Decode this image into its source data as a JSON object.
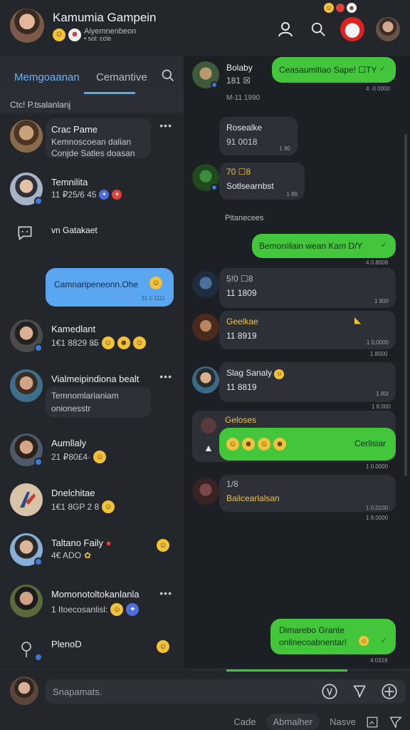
{
  "header": {
    "title": "Kamumia Gampein",
    "subtitle": "Aiyemnenbeon",
    "subtitle2": "• sol: ccle",
    "icons": [
      "user-icon",
      "search-icon",
      "notification-avatar",
      "profile-avatar"
    ]
  },
  "tabs": {
    "tab1": "Memgoaanan",
    "tab2": "Cemantive"
  },
  "section_label": "Ctc! P.tsalanlanj",
  "chats": [
    {
      "name": "Crac Pame",
      "line1": "Kemnoscoean dalian",
      "line2": "Conjde Satles doasan"
    },
    {
      "name": "Temnilita",
      "line1": "11 ₽25/6 45"
    },
    {
      "name": "vn Gatakaet"
    },
    {
      "name": "Kamedlant",
      "line1": "1€1 8829 8̶5"
    },
    {
      "name": "Vialmeipindiona bealt",
      "line1": "Temnomlarianiam",
      "line2": "onionesstr"
    },
    {
      "name": "Aumllaly",
      "line1": "21 ₽80£4·"
    },
    {
      "name": "Dnelchitae",
      "line1": "1€1 8GP 2 8"
    },
    {
      "name": "Taltano Faily",
      "line1": "4€ ADO"
    },
    {
      "name": "Momonotoltokanlanla",
      "line1": "1 Itoecosanlisl:"
    },
    {
      "name": "PlenoD"
    }
  ],
  "left_bubble": {
    "text": "Camnaripeneonn.Ohe",
    "time": "31 1 1111"
  },
  "messages": {
    "m1": {
      "name": "Bolaby",
      "line": "181 ☒",
      "meta": "M-11 1990"
    },
    "m1_out": {
      "text": "Ceasaumitiao Sape! ☐TY",
      "time": "4 ·0 0000"
    },
    "m2": {
      "name": "Rosealke",
      "line": "91 0018",
      "time": "1 80"
    },
    "m3": {
      "name": "70 ☐8",
      "line": "Sotlsearnbst",
      "time": "1 89"
    },
    "day": "Pitanecees",
    "m4_out": {
      "text": "Bemoniilain wean Kam D/Y",
      "time": "4 0.8008"
    },
    "m5": {
      "name": "5!0 ☐8",
      "line": "11 1809",
      "time": "1 800"
    },
    "m6": {
      "name": "Geelkae",
      "line": "11 8919",
      "time": "1 0,0000"
    },
    "m6_time2": "1.8000",
    "m7": {
      "name": "Slag Sanaly",
      "line": "11 8819",
      "time": "1 80/",
      "time2": "1 8.000"
    },
    "m8": {
      "name": "Geloses",
      "bubble_label": "Cerlisiar",
      "time": "1 0.0000"
    },
    "m9": {
      "name": "1/8",
      "line": "Bailcearlalsan",
      "time": "1 0,0100",
      "time2": "1 8.0000"
    },
    "m10_out": {
      "line1": "Dimarebo Grante",
      "line2": "onlinecoabnentarl",
      "time": "4 0319"
    }
  },
  "composer": {
    "placeholder": "Snapamats.",
    "links": [
      "Cade",
      "Abmalher",
      "Nasve"
    ]
  },
  "colors": {
    "accent_blue": "#5aa7f2",
    "green_bubble": "#43c53c",
    "bg": "#1f2227"
  }
}
